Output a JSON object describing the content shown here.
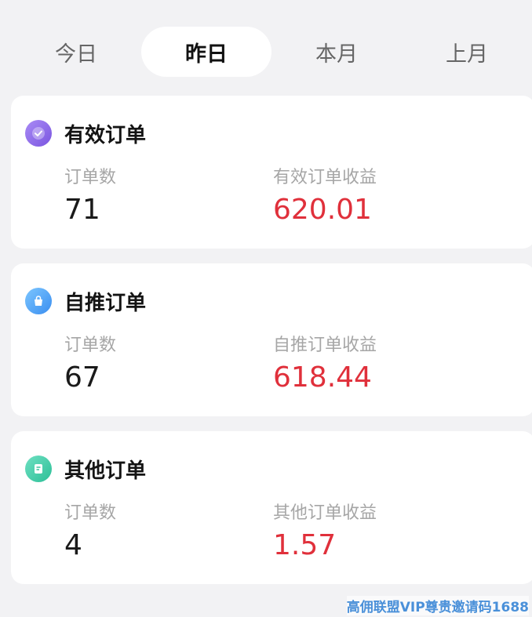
{
  "tabs": [
    {
      "label": "今日",
      "active": false
    },
    {
      "label": "昨日",
      "active": true
    },
    {
      "label": "本月",
      "active": false
    },
    {
      "label": "上月",
      "active": false
    }
  ],
  "cards": [
    {
      "icon": "check-circle-icon",
      "icon_color": "#8a63e8",
      "title": "有效订单",
      "count_label": "订单数",
      "count": "71",
      "amount_label": "有效订单收益",
      "amount": "620.01"
    },
    {
      "icon": "shopping-bag-icon",
      "icon_color": "#4aa3f5",
      "title": "自推订单",
      "count_label": "订单数",
      "count": "67",
      "amount_label": "自推订单收益",
      "amount": "618.44"
    },
    {
      "icon": "document-icon",
      "icon_color": "#3ecba8",
      "title": "其他订单",
      "count_label": "订单数",
      "count": "4",
      "amount_label": "其他订单收益",
      "amount": "1.57"
    }
  ],
  "colors": {
    "amount": "#e0303b",
    "active_tab_bg": "#ffffff",
    "page_bg": "#f2f2f4"
  },
  "watermark": "高佣联盟VIP尊贵邀请码1688"
}
